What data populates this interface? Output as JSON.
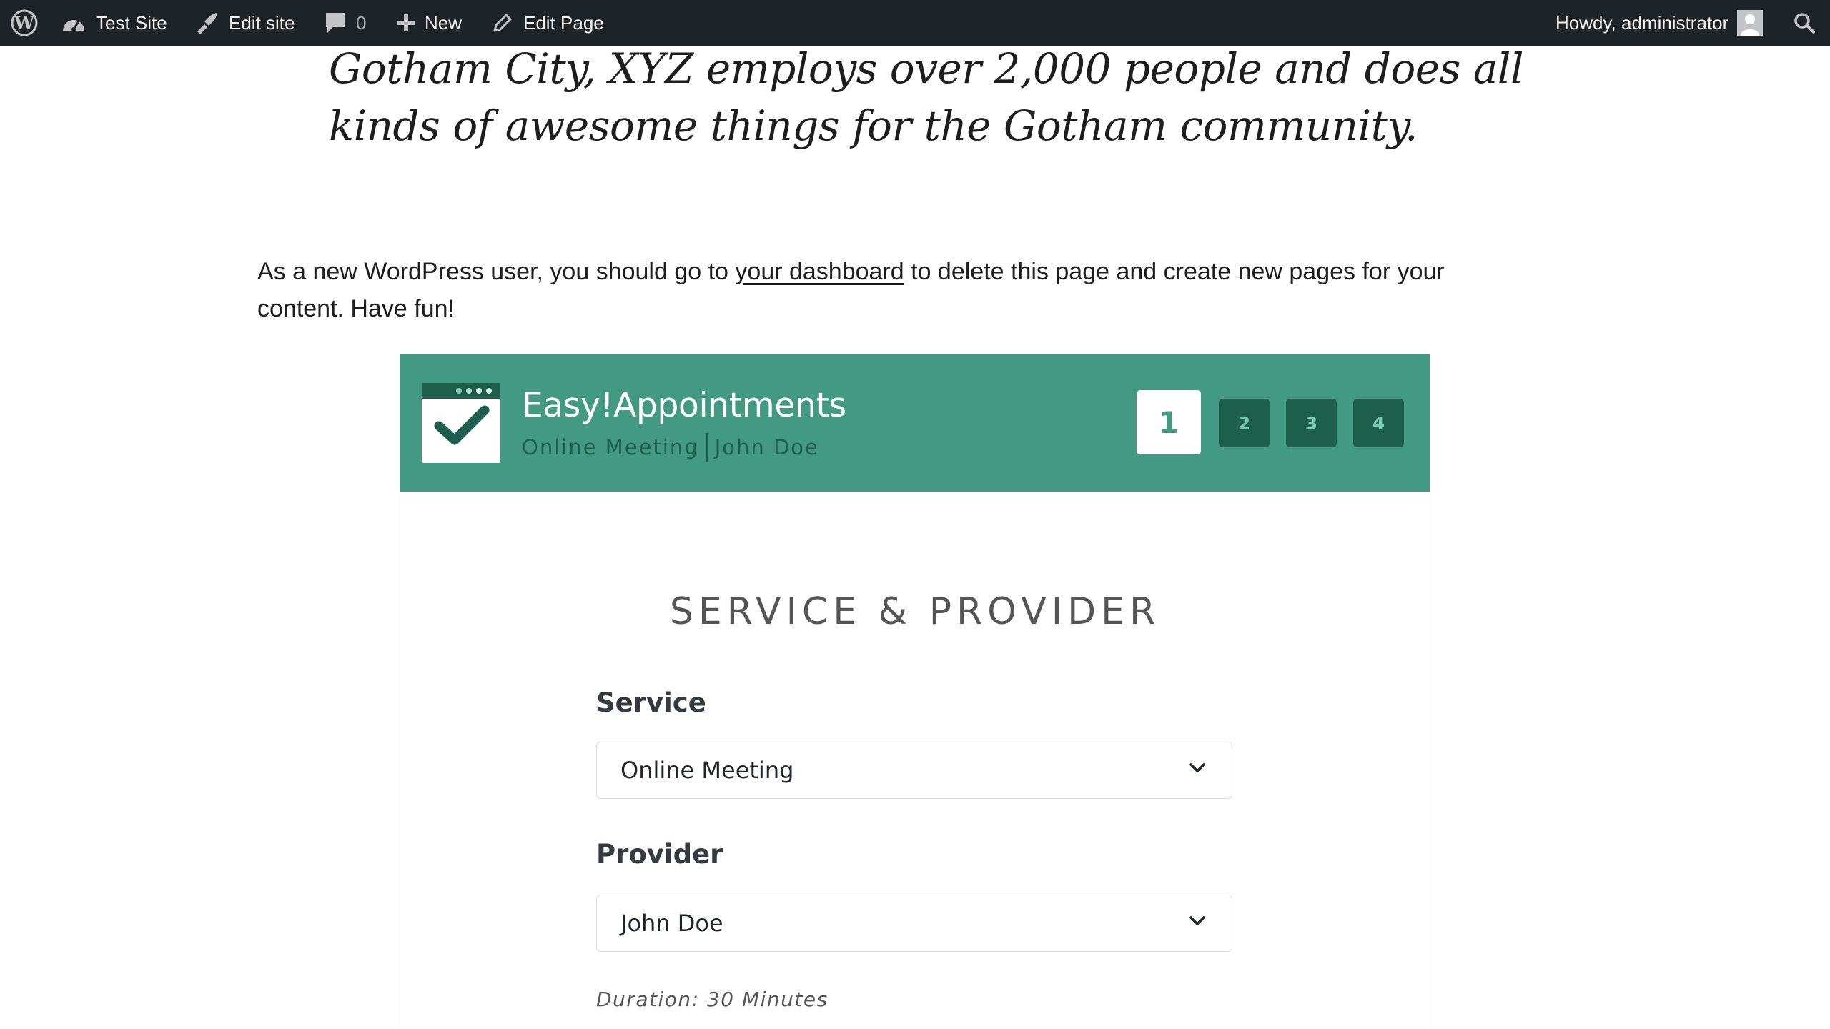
{
  "admin_bar": {
    "site_name": "Test Site",
    "edit_site": "Edit site",
    "comments_count": "0",
    "new": "New",
    "edit_page": "Edit Page",
    "greeting": "Howdy, administrator"
  },
  "content": {
    "quote": "Gotham City, XYZ employs over 2,000 people and does all kinds of awesome things for the Gotham community.",
    "paragraph_before_link": "As a new WordPress user, you should go to ",
    "dashboard_link": "your dashboard",
    "paragraph_after_link": " to delete this page and create new pages for your content. Have fun!"
  },
  "booking": {
    "company_name": "Easy!Appointments",
    "selected_service": "Online Meeting",
    "selected_provider": "John Doe",
    "steps": [
      "1",
      "2",
      "3",
      "4"
    ],
    "active_step": 1,
    "step_title": "SERVICE & PROVIDER",
    "service_label": "Service",
    "service_value": "Online Meeting",
    "provider_label": "Provider",
    "provider_value": "John Doe",
    "duration": "Duration: 30 Minutes"
  },
  "colors": {
    "admin_bar_bg": "#1d2327",
    "booking_accent": "#429a82",
    "booking_dark": "#1e5e4c"
  }
}
